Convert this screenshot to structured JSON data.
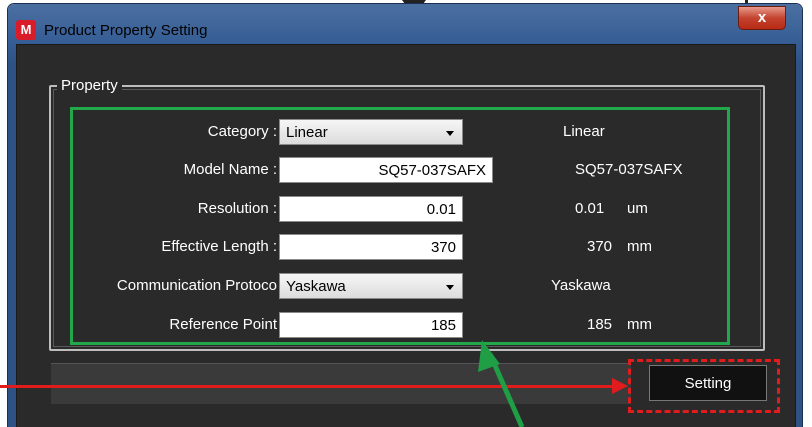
{
  "window": {
    "title": "Product Property Setting",
    "app_icon_letter": "M",
    "close_glyph": "x"
  },
  "group": {
    "label": "Property"
  },
  "rows": [
    {
      "label": "Category :",
      "input_type": "combo",
      "value": "Linear",
      "display": "Linear",
      "unit": ""
    },
    {
      "label": "Model Name :",
      "input_type": "text",
      "value": "SQ57-037SAFX",
      "display": "SQ57-037SAFX",
      "unit": ""
    },
    {
      "label": "Resolution :",
      "input_type": "text",
      "value": "0.01",
      "display": "0.01",
      "unit": "um"
    },
    {
      "label": "Effective Length :",
      "input_type": "text",
      "value": "370",
      "display": "370",
      "unit": "mm"
    },
    {
      "label": "Communication Protoco",
      "input_type": "combo",
      "value": "Yaskawa",
      "display": "Yaskawa",
      "unit": ""
    },
    {
      "label": "Reference Point",
      "input_type": "text",
      "value": "185",
      "display": "185",
      "unit": "mm"
    }
  ],
  "buttons": {
    "setting": "Setting"
  },
  "colors": {
    "highlight_green": "#22a84a",
    "highlight_red": "#e01c1c",
    "window_bg": "#2a2a2a"
  }
}
